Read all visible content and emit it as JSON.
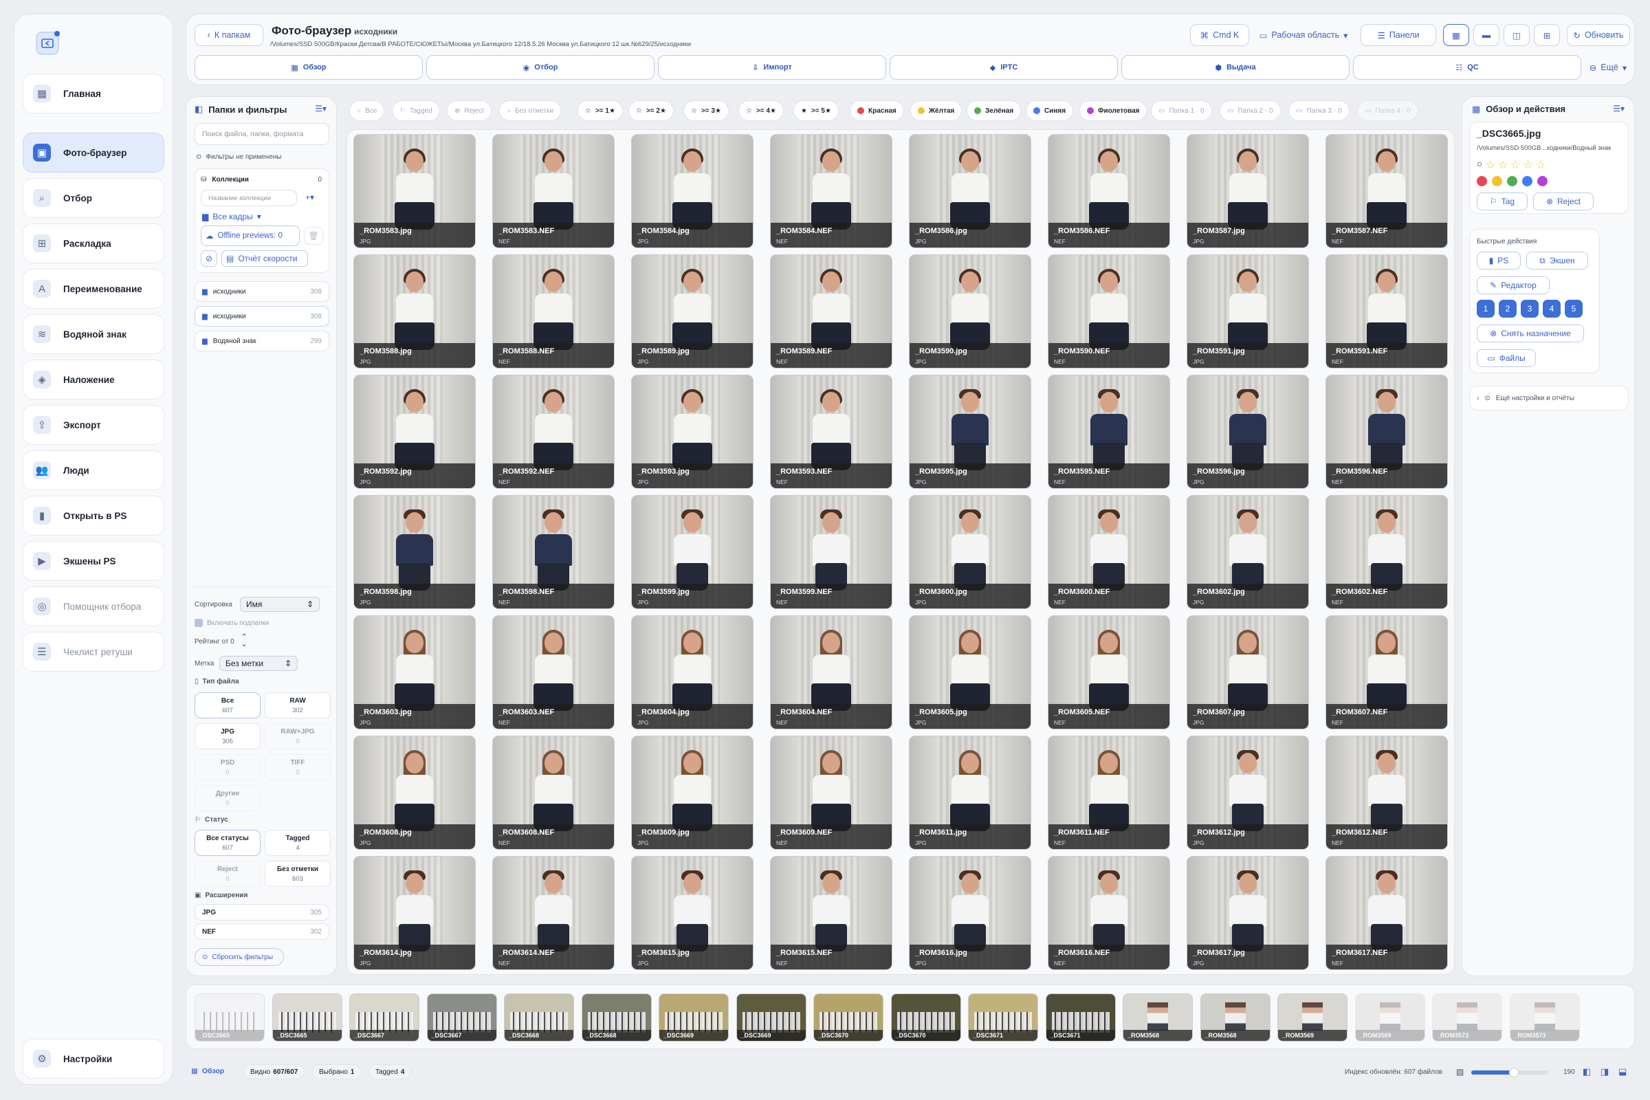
{
  "sidebar": {
    "items": [
      {
        "label": "Главная",
        "icon": "grid-icon"
      },
      {
        "label": "Фото-браузер",
        "icon": "photo-icon",
        "active": true
      },
      {
        "label": "Отбор",
        "icon": "search-icon"
      },
      {
        "label": "Раскладка",
        "icon": "layout-grid-icon"
      },
      {
        "label": "Переименование",
        "icon": "rename-icon"
      },
      {
        "label": "Водяной знак",
        "icon": "waves-icon"
      },
      {
        "label": "Наложение",
        "icon": "layers-icon"
      },
      {
        "label": "Экспорт",
        "icon": "export-icon"
      },
      {
        "label": "Люди",
        "icon": "people-icon"
      },
      {
        "label": "Открыть в PS",
        "icon": "ps-icon"
      },
      {
        "label": "Экшены PS",
        "icon": "actions-icon"
      },
      {
        "label": "Помощник отбора",
        "icon": "assistant-icon",
        "muted": true
      },
      {
        "label": "Чеклист ретуши",
        "icon": "checklist-icon",
        "muted": true
      }
    ],
    "settings": "Настройки"
  },
  "header": {
    "back": "К папкам",
    "title": "Фото-браузер",
    "subtitle": "исходники",
    "path": "/Volumes/SSD 500GB/Краски Детсва/В РАБОТЕ/СЮЖЕТЫ/Москва ул.Батицкого 12/18.5.26 Москва ул.Батицкого 12 шк.№629/25/исходники",
    "cmdk": "Cmd K",
    "workspace": "Рабочая область",
    "panels": "Панели",
    "refresh": "Обновить",
    "more": "Ещё",
    "tabs": [
      "Обзор",
      "Отбор",
      "Импорт",
      "IPTC",
      "Выдача",
      "QC"
    ]
  },
  "filters": {
    "title": "Папки и фильтры",
    "search_placeholder": "Поиск файла, папки, формата",
    "none_applied": "Фильтры не применены",
    "collections_label": "Коллекции",
    "collections_count": "0",
    "collection_name_placeholder": "Название коллекции",
    "all_frames": "Все кадры",
    "offline": "Offline previews: 0",
    "speed_report": "Отчёт скорости",
    "folders": [
      {
        "name": "исходники",
        "count": "308"
      },
      {
        "name": "исходники",
        "count": "308"
      },
      {
        "name": "Водяной знак",
        "count": "299"
      }
    ],
    "sort_label": "Сортировка",
    "sort_value": "Имя",
    "include_sub": "Включать подпапки",
    "rating_label": "Рейтинг от 0",
    "mark_label": "Метка",
    "mark_value": "Без метки",
    "filetype_label": "Тип файла",
    "filetypes": [
      {
        "name": "Все",
        "count": "607"
      },
      {
        "name": "RAW",
        "count": "302"
      },
      {
        "name": "JPG",
        "count": "305"
      },
      {
        "name": "RAW+JPG",
        "count": "0"
      },
      {
        "name": "PSD",
        "count": "0"
      },
      {
        "name": "TIFF",
        "count": "0"
      },
      {
        "name": "Другие",
        "count": "0"
      }
    ],
    "status_label": "Статус",
    "statuses": [
      {
        "name": "Все статусы",
        "count": "607"
      },
      {
        "name": "Tagged",
        "count": "4"
      },
      {
        "name": "Reject",
        "count": "0"
      },
      {
        "name": "Без отметки",
        "count": "603"
      }
    ],
    "ext_label": "Расширения",
    "exts": [
      {
        "name": "JPG",
        "count": "305"
      },
      {
        "name": "NEF",
        "count": "302"
      }
    ],
    "reset": "Сбросить фильтры"
  },
  "chips": {
    "all": "Все",
    "tagged": "Tagged",
    "reject": "Reject",
    "unmarked": "Без отметки",
    "r1": ">= 1★",
    "r2": ">= 2★",
    "r3": ">= 3★",
    "r4": ">= 4★",
    "r5": ">= 5★",
    "red": "Красная",
    "yellow": "Жёлтая",
    "green": "Зелёная",
    "blue": "Синяя",
    "purple": "Фиолетовая",
    "f1": "Папка 1 · 0",
    "f2": "Папка 2 · 0",
    "f3": "Папка 3 · 0",
    "f4": "Папка 4 · 0"
  },
  "photos": [
    {
      "name": "_ROM3583.jpg",
      "type": "JPG",
      "kind": "girl"
    },
    {
      "name": "_ROM3583.NEF",
      "type": "NEF",
      "kind": "girl"
    },
    {
      "name": "_ROM3584.jpg",
      "type": "JPG",
      "kind": "girl"
    },
    {
      "name": "_ROM3584.NEF",
      "type": "NEF",
      "kind": "girl"
    },
    {
      "name": "_ROM3586.jpg",
      "type": "JPG",
      "kind": "girl"
    },
    {
      "name": "_ROM3586.NEF",
      "type": "NEF",
      "kind": "girl"
    },
    {
      "name": "_ROM3587.jpg",
      "type": "JPG",
      "kind": "girl"
    },
    {
      "name": "_ROM3587.NEF",
      "type": "NEF",
      "kind": "girl"
    },
    {
      "name": "_ROM3588.jpg",
      "type": "JPG",
      "kind": "girl"
    },
    {
      "name": "_ROM3588.NEF",
      "type": "NEF",
      "kind": "girl"
    },
    {
      "name": "_ROM3589.jpg",
      "type": "JPG",
      "kind": "girl"
    },
    {
      "name": "_ROM3589.NEF",
      "type": "NEF",
      "kind": "girl"
    },
    {
      "name": "_ROM3590.jpg",
      "type": "JPG",
      "kind": "girl"
    },
    {
      "name": "_ROM3590.NEF",
      "type": "NEF",
      "kind": "girl"
    },
    {
      "name": "_ROM3591.jpg",
      "type": "JPG",
      "kind": "girl"
    },
    {
      "name": "_ROM3591.NEF",
      "type": "NEF",
      "kind": "girl"
    },
    {
      "name": "_ROM3592.jpg",
      "type": "JPG",
      "kind": "girl"
    },
    {
      "name": "_ROM3592.NEF",
      "type": "NEF",
      "kind": "girl"
    },
    {
      "name": "_ROM3593.jpg",
      "type": "JPG",
      "kind": "girl"
    },
    {
      "name": "_ROM3593.NEF",
      "type": "NEF",
      "kind": "girl"
    },
    {
      "name": "_ROM3595.jpg",
      "type": "JPG",
      "kind": "suit"
    },
    {
      "name": "_ROM3595.NEF",
      "type": "NEF",
      "kind": "suit"
    },
    {
      "name": "_ROM3596.jpg",
      "type": "JPG",
      "kind": "suit"
    },
    {
      "name": "_ROM3596.NEF",
      "type": "NEF",
      "kind": "suit"
    },
    {
      "name": "_ROM3598.jpg",
      "type": "JPG",
      "kind": "suit"
    },
    {
      "name": "_ROM3598.NEF",
      "type": "NEF",
      "kind": "suit"
    },
    {
      "name": "_ROM3599.jpg",
      "type": "JPG",
      "kind": "boy"
    },
    {
      "name": "_ROM3599.NEF",
      "type": "NEF",
      "kind": "boy"
    },
    {
      "name": "_ROM3600.jpg",
      "type": "JPG",
      "kind": "boy"
    },
    {
      "name": "_ROM3600.NEF",
      "type": "NEF",
      "kind": "boy"
    },
    {
      "name": "_ROM3602.jpg",
      "type": "JPG",
      "kind": "boy"
    },
    {
      "name": "_ROM3602.NEF",
      "type": "NEF",
      "kind": "boy"
    },
    {
      "name": "_ROM3603.jpg",
      "type": "JPG",
      "kind": "girl2"
    },
    {
      "name": "_ROM3603.NEF",
      "type": "NEF",
      "kind": "girl2"
    },
    {
      "name": "_ROM3604.jpg",
      "type": "JPG",
      "kind": "girl2"
    },
    {
      "name": "_ROM3604.NEF",
      "type": "NEF",
      "kind": "girl2"
    },
    {
      "name": "_ROM3605.jpg",
      "type": "JPG",
      "kind": "girl2"
    },
    {
      "name": "_ROM3605.NEF",
      "type": "NEF",
      "kind": "girl2"
    },
    {
      "name": "_ROM3607.jpg",
      "type": "JPG",
      "kind": "girl2"
    },
    {
      "name": "_ROM3607.NEF",
      "type": "NEF",
      "kind": "girl2"
    },
    {
      "name": "_ROM3608.jpg",
      "type": "JPG",
      "kind": "girl2"
    },
    {
      "name": "_ROM3608.NEF",
      "type": "NEF",
      "kind": "girl2"
    },
    {
      "name": "_ROM3609.jpg",
      "type": "JPG",
      "kind": "girl2"
    },
    {
      "name": "_ROM3609.NEF",
      "type": "NEF",
      "kind": "girl2"
    },
    {
      "name": "_ROM3611.jpg",
      "type": "JPG",
      "kind": "girl2"
    },
    {
      "name": "_ROM3611.NEF",
      "type": "NEF",
      "kind": "girl2"
    },
    {
      "name": "_ROM3612.jpg",
      "type": "JPG",
      "kind": "boy"
    },
    {
      "name": "_ROM3612.NEF",
      "type": "NEF",
      "kind": "boy"
    },
    {
      "name": "_ROM3614.jpg",
      "type": "JPG",
      "kind": "boy"
    },
    {
      "name": "_ROM3614.NEF",
      "type": "NEF",
      "kind": "boy"
    },
    {
      "name": "_ROM3615.jpg",
      "type": "JPG",
      "kind": "boy"
    },
    {
      "name": "_ROM3615.NEF",
      "type": "NEF",
      "kind": "boy"
    },
    {
      "name": "_ROM3616.jpg",
      "type": "JPG",
      "kind": "boy"
    },
    {
      "name": "_ROM3616.NEF",
      "type": "NEF",
      "kind": "boy"
    },
    {
      "name": "_ROM3617.jpg",
      "type": "JPG",
      "kind": "boy"
    },
    {
      "name": "_ROM3617.NEF",
      "type": "NEF",
      "kind": "boy"
    }
  ],
  "details": {
    "title": "Обзор и действия",
    "filename": "_DSC3665.jpg",
    "path": "/Volumes/SSD 500GB...ходники/Водный знак",
    "colors": [
      "#e5484d",
      "#f1c232",
      "#4caf50",
      "#3d7ff0",
      "#b83fd6"
    ],
    "tag": "Tag",
    "reject": "Reject",
    "quick_title": "Быстрые действия",
    "ps": "PS",
    "actions": "Экшен",
    "editor": "Редактор",
    "nums": [
      "1",
      "2",
      "3",
      "4",
      "5"
    ],
    "unassign": "Снять назначение",
    "files": "Файлы",
    "more_settings": "Ещё настройки и отчёты"
  },
  "filmstrip": [
    {
      "label": "_DSC3665",
      "bg": "#e9eaee",
      "fade": true
    },
    {
      "label": "_DSC3665",
      "bg": "#dcdad2"
    },
    {
      "label": "_DSC3667",
      "bg": "#dad7cb"
    },
    {
      "label": "_DSC3667",
      "bg": "#8a8d88"
    },
    {
      "label": "_DSC3668",
      "bg": "#c8c3ac"
    },
    {
      "label": "_DSC3668",
      "bg": "#7c7f6c"
    },
    {
      "label": "_DSC3669",
      "bg": "#b9a873"
    },
    {
      "label": "_DSC3669",
      "bg": "#5f5b3d"
    },
    {
      "label": "_DSC3670",
      "bg": "#b5a46a"
    },
    {
      "label": "_DSC3670",
      "bg": "#55533a"
    },
    {
      "label": "_DSC3671",
      "bg": "#c1b27b"
    },
    {
      "label": "_DSC3671",
      "bg": "#4f4d38"
    },
    {
      "label": "_ROM3568",
      "bg": "#d8d7d2",
      "solo": true
    },
    {
      "label": "_ROM3568",
      "bg": "#cfcec9",
      "solo": true
    },
    {
      "label": "_ROM3569",
      "bg": "#d8d7d2",
      "solo": true
    },
    {
      "label": "_ROM3569",
      "bg": "#cfcec9",
      "solo": true,
      "fade": true
    },
    {
      "label": "_ROM3573",
      "bg": "#d8d7d2",
      "solo": true,
      "fade": true
    },
    {
      "label": "_ROM3573",
      "bg": "#d8d7d2",
      "solo": true,
      "fade": true
    }
  ],
  "statusbar": {
    "overview": "Обзор",
    "visible_label": "Видно",
    "visible_value": "607/607",
    "selected_label": "Выбрано",
    "selected_value": "1",
    "tagged_label": "Tagged",
    "tagged_value": "4",
    "index": "Индекс обновлён: 607 файлов",
    "zoom": "190",
    "zoom_fraction": 0.55
  }
}
